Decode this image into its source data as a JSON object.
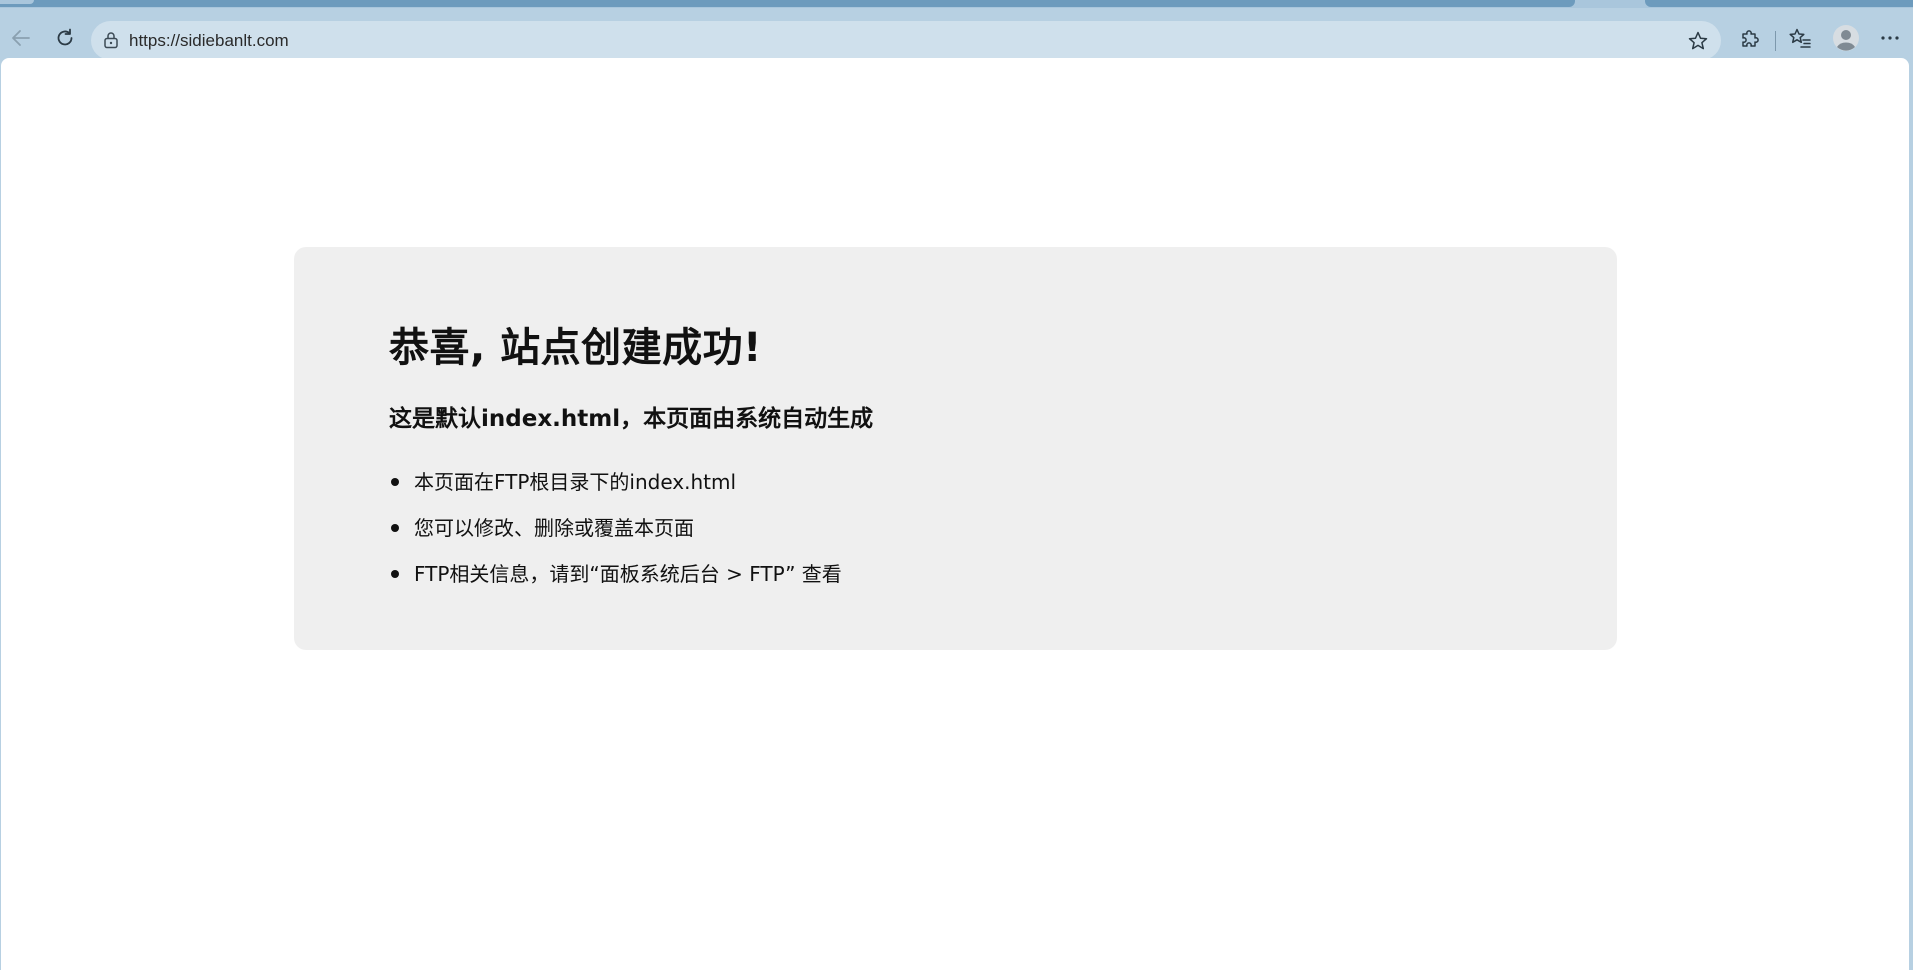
{
  "browser": {
    "url": "https://sidiebanlt.com",
    "icons": {
      "back": "back-arrow-icon",
      "reload": "reload-icon",
      "lock": "lock-icon",
      "favorite": "star-icon",
      "extensions": "puzzle-icon",
      "favorites_list": "favorites-list-icon",
      "profile": "avatar-icon",
      "menu": "more-icon"
    }
  },
  "page": {
    "heading": "恭喜, 站点创建成功!",
    "subheading": "这是默认index.html，本页面由系统自动生成",
    "items": [
      "本页面在FTP根目录下的index.html",
      "您可以修改、删除或覆盖本页面",
      "FTP相关信息，请到“面板系统后台 > FTP” 查看"
    ]
  },
  "colors": {
    "browser_frame": "#b7d0e2",
    "address_bar": "#cfe0ec",
    "card_background": "#efefef"
  }
}
